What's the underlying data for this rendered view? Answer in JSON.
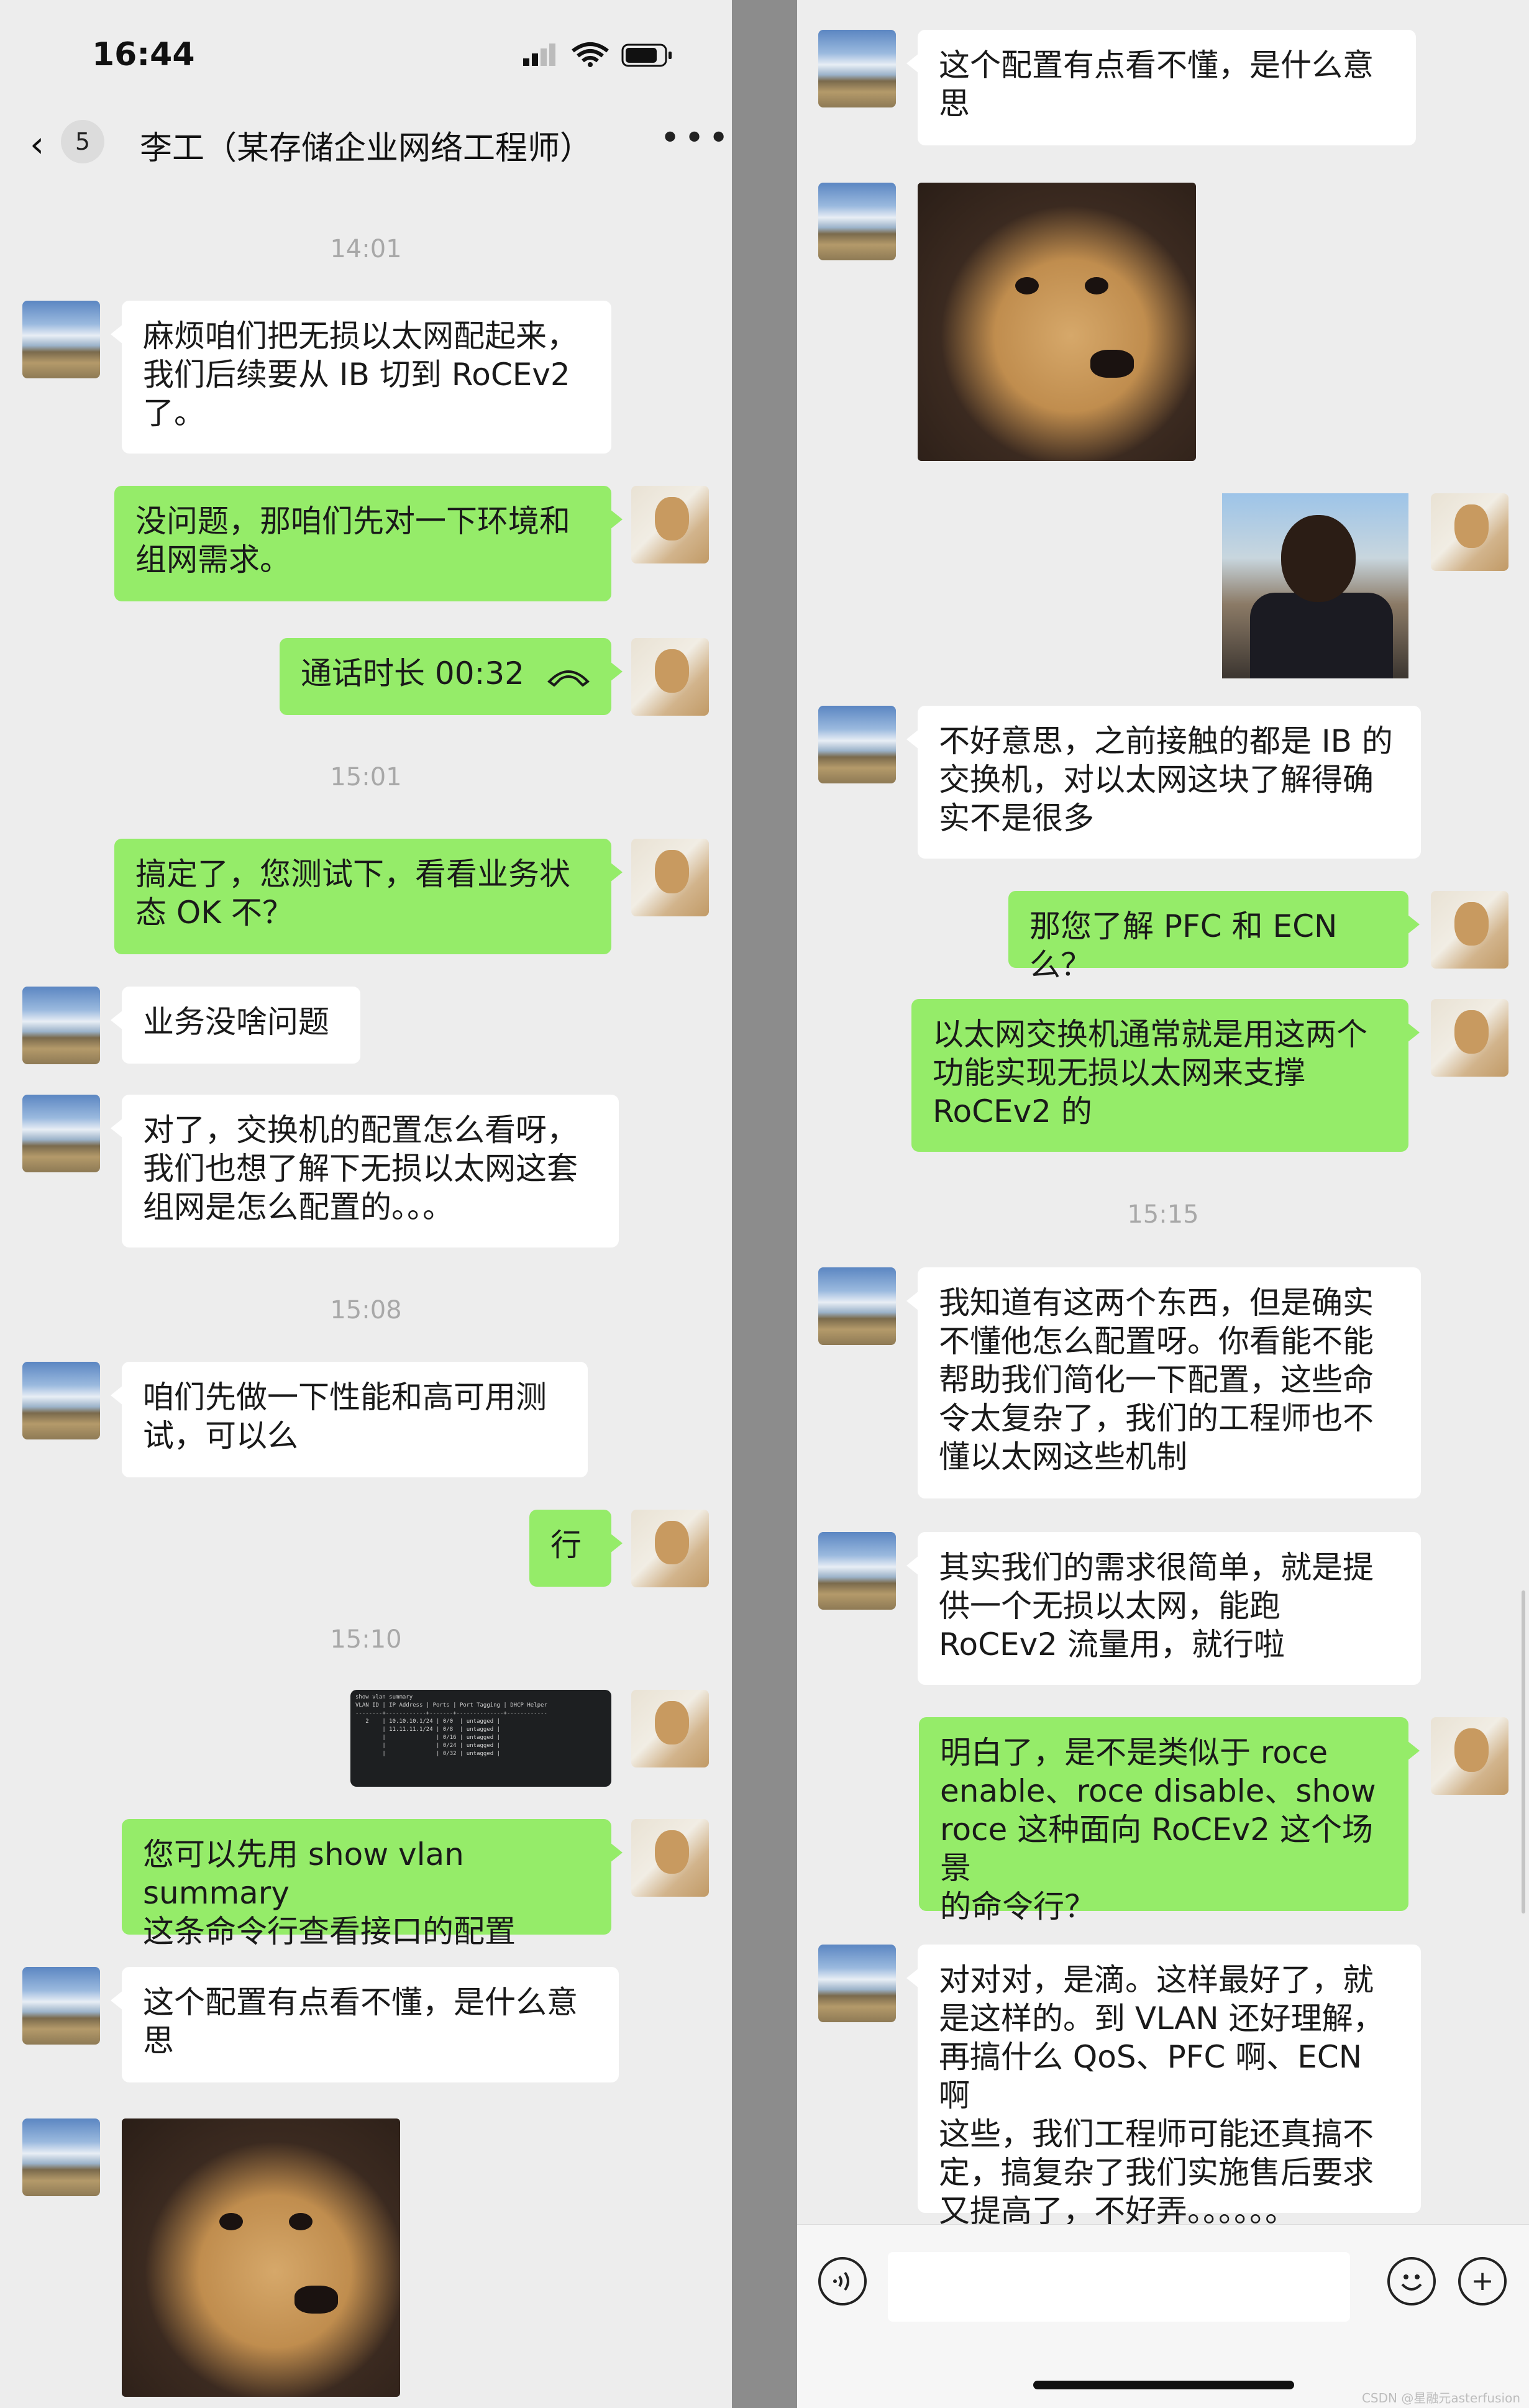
{
  "status_bar": {
    "time": "16:44"
  },
  "header": {
    "back_count": "5",
    "title": "李工（某存储企业网络工程师）",
    "more": "•••"
  },
  "left": {
    "timestamps": [
      "14:01",
      "15:01",
      "15:08",
      "15:10"
    ],
    "messages": [
      "麻烦咱们把无损以太网配起来，\n我们后续要从 IB 切到 RoCEv2\n了。",
      "没问题，那咱们先对一下环境和\n组网需求。",
      "通话时长 00:32",
      "搞定了，您测试下，看看业务状\n态 OK 不？",
      "业务没啥问题",
      "对了，交换机的配置怎么看呀，\n我们也想了解下无损以太网这套\n组网是怎么配置的。。。",
      "咱们先做一下性能和高可用测\n试，可以么",
      "行",
      "您可以先用 show vlan summary\n这条命令行查看接口的配置",
      "这个配置有点看不懂，是什么意\n思"
    ],
    "terminal": "show vlan summary\nVLAN ID | IP Address | Ports | Port Tagging | DHCP Helper\n--------+------------+-------+--------------+------------\n   2    | 10.10.10.1/24 | 0/0  | untagged |\n        | 11.11.11.1/24 | 0/8  | untagged |\n        |               | 0/16 | untagged |\n        |               | 0/24 | untagged |\n        |               | 0/32 | untagged |"
  },
  "right": {
    "timestamps": [
      "15:15"
    ],
    "messages": [
      "这个配置有点看不懂，是什么意\n思",
      "不好意思，之前接触的都是 IB 的\n交换机，对以太网这块了解得确\n实不是很多",
      "那您了解 PFC 和 ECN 么？",
      "以太网交换机通常就是用这两个\n功能实现无损以太网来支撑\nRoCEv2 的",
      "我知道有这两个东西，但是确实\n不懂他怎么配置呀。你看能不能\n帮助我们简化一下配置，这些命\n令太复杂了，我们的工程师也不\n懂以太网这些机制",
      "其实我们的需求很简单，就是提\n供一个无损以太网，能跑\nRoCEv2 流量用，就行啦",
      "明白了，是不是类似于 roce\nenable、roce disable、show\nroce 这种面向 RoCEv2 这个场景\n的命令行？",
      "对对对，是滴。这样最好了，就\n是这样的。到 VLAN 还好理解，\n再搞什么 QoS、PFC 啊、ECN 啊\n这些，我们工程师可能还真搞不\n定，搞复杂了我们实施售后要求\n又提高了，不好弄。。。。。。"
    ],
    "input": {
      "placeholder": ""
    }
  },
  "icons": [
    "chevron-left-icon",
    "more-icon",
    "phone-icon",
    "voice-icon",
    "emoji-icon",
    "plus-icon"
  ],
  "watermark": "CSDN @星融元asterfusion"
}
